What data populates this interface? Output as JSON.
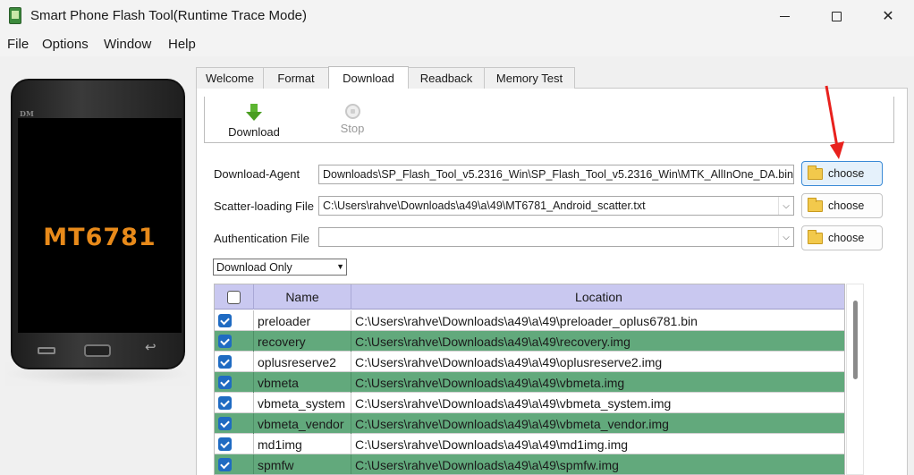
{
  "window": {
    "title": "Smart Phone Flash Tool(Runtime Trace Mode)"
  },
  "menu": [
    "File",
    "Options",
    "Window",
    "Help"
  ],
  "phone": {
    "brand": "DM",
    "chip": "MT6781"
  },
  "tabs": [
    "Welcome",
    "Format",
    "Download",
    "Readback",
    "Memory Test"
  ],
  "active_tab": "Download",
  "toolbar": {
    "download_label": "Download",
    "stop_label": "Stop"
  },
  "form": {
    "download_agent": {
      "label": "Download-Agent",
      "value": "Downloads\\SP_Flash_Tool_v5.2316_Win\\SP_Flash_Tool_v5.2316_Win\\MTK_AllInOne_DA.bin"
    },
    "scatter": {
      "label": "Scatter-loading File",
      "value": "C:\\Users\\rahve\\Downloads\\a49\\a\\49\\MT6781_Android_scatter.txt"
    },
    "auth": {
      "label": "Authentication File",
      "value": ""
    },
    "choose_label": "choose",
    "mode": "Download Only"
  },
  "table": {
    "headers": [
      "Name",
      "Location"
    ],
    "rows": [
      {
        "checked": true,
        "name": "preloader",
        "location": "C:\\Users\\rahve\\Downloads\\a49\\a\\49\\preloader_oplus6781.bin",
        "highlight": false
      },
      {
        "checked": true,
        "name": "recovery",
        "location": "C:\\Users\\rahve\\Downloads\\a49\\a\\49\\recovery.img",
        "highlight": true
      },
      {
        "checked": true,
        "name": "oplusreserve2",
        "location": "C:\\Users\\rahve\\Downloads\\a49\\a\\49\\oplusreserve2.img",
        "highlight": false
      },
      {
        "checked": true,
        "name": "vbmeta",
        "location": "C:\\Users\\rahve\\Downloads\\a49\\a\\49\\vbmeta.img",
        "highlight": true
      },
      {
        "checked": true,
        "name": "vbmeta_system",
        "location": "C:\\Users\\rahve\\Downloads\\a49\\a\\49\\vbmeta_system.img",
        "highlight": false
      },
      {
        "checked": true,
        "name": "vbmeta_vendor",
        "location": "C:\\Users\\rahve\\Downloads\\a49\\a\\49\\vbmeta_vendor.img",
        "highlight": true
      },
      {
        "checked": true,
        "name": "md1img",
        "location": "C:\\Users\\rahve\\Downloads\\a49\\a\\49\\md1img.img",
        "highlight": false
      },
      {
        "checked": true,
        "name": "spmfw",
        "location": "C:\\Users\\rahve\\Downloads\\a49\\a\\49\\spmfw.img",
        "highlight": true
      }
    ]
  },
  "colors": {
    "header_bg": "#c9c8f0",
    "highlight_row": "#62a97c",
    "checkbox": "#1f6bc2",
    "annotation_arrow": "#e8211d"
  }
}
